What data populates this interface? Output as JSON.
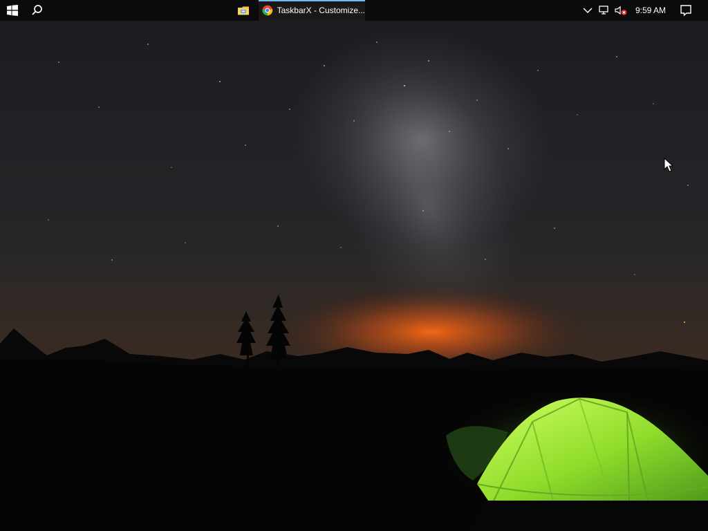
{
  "taskbar": {
    "start_icon": "windows-start-icon",
    "search_icon": "search-icon",
    "pinned": [
      {
        "name": "file-explorer",
        "icon": "folder-icon"
      }
    ],
    "active_task": {
      "icon": "chrome-icon",
      "label": "TaskbarX - Customize...",
      "accent": "#76b9ed"
    },
    "tray": {
      "chevron_icon": "chevron-up-icon",
      "network_icon": "network-icon",
      "volume_icon": "volume-muted-icon",
      "time": "9:59 AM",
      "notification_icon": "notification-icon"
    }
  },
  "desktop": {
    "wallpaper": "night-sky-milky-way-green-tent",
    "colors": {
      "sky_top": "#1c1d20",
      "sunset_glow": "#d95c14",
      "tent": "#8de32e"
    }
  }
}
